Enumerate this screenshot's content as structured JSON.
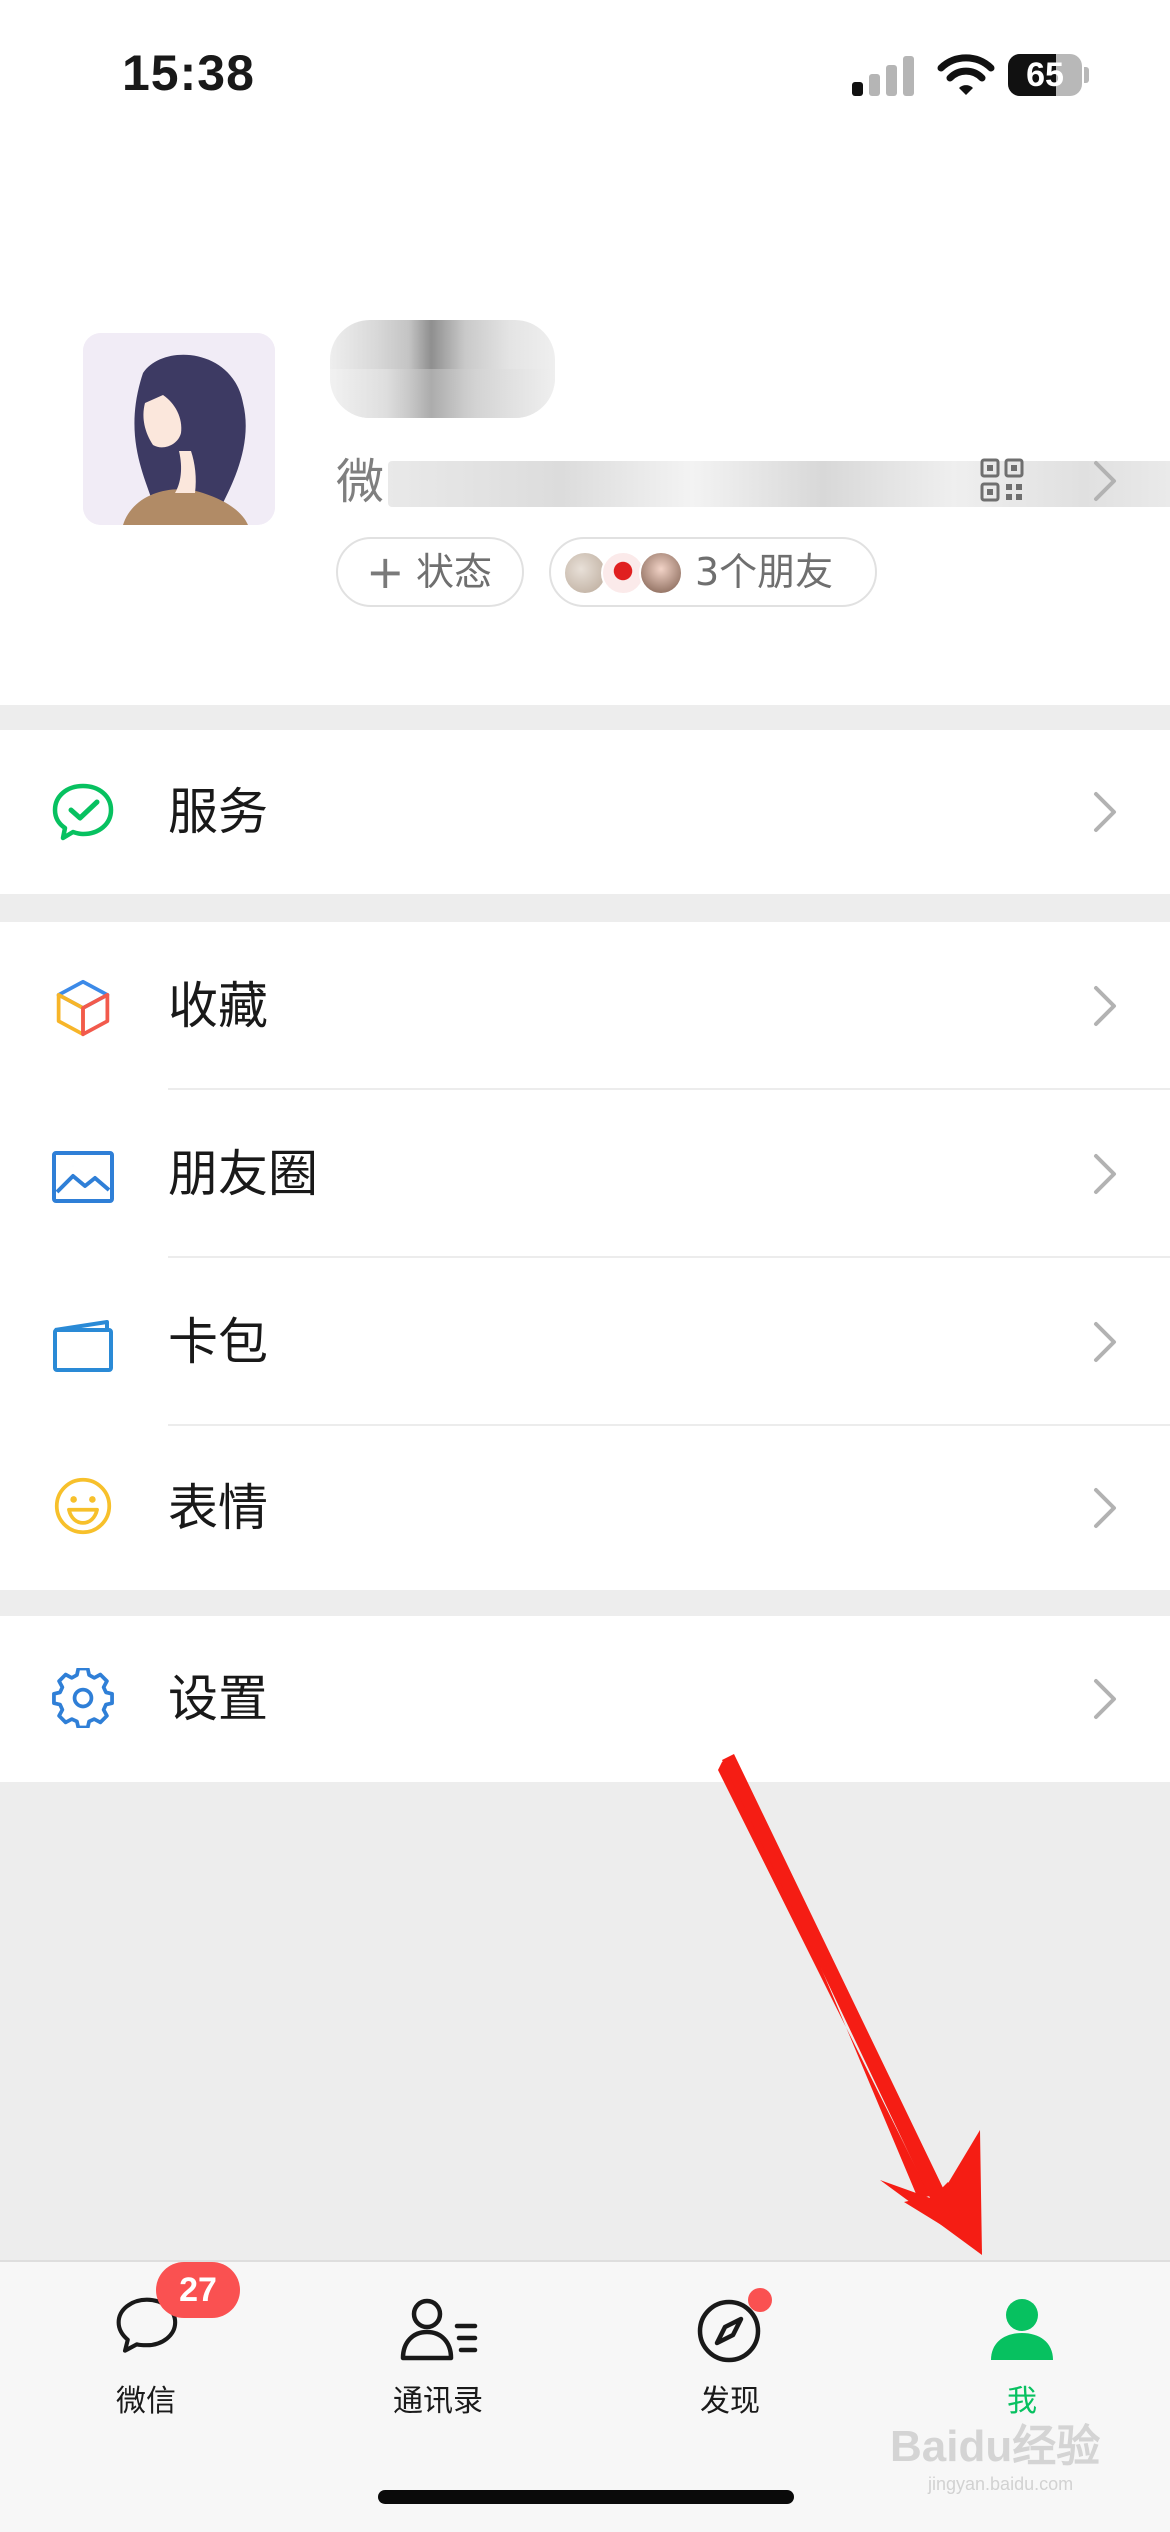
{
  "status_bar": {
    "time": "15:38",
    "battery_level": "65",
    "battery_fraction": 0.65
  },
  "profile": {
    "wechat_id_label": "微",
    "status_chip": {
      "plus": "+",
      "label": "状态"
    },
    "friends_chip": {
      "label": "3个朋友"
    }
  },
  "menu": {
    "services": {
      "label": "服务",
      "icon": "services-icon",
      "color": "#07c160"
    },
    "favorites": {
      "label": "收藏",
      "icon": "favorites-cube-icon"
    },
    "moments": {
      "label": "朋友圈",
      "icon": "moments-photo-icon",
      "color": "#2f7fd7"
    },
    "cards": {
      "label": "卡包",
      "icon": "card-wallet-icon",
      "color": "#2a8ad6"
    },
    "stickers": {
      "label": "表情",
      "icon": "smiley-icon",
      "color": "#f7c02b"
    },
    "settings": {
      "label": "设置",
      "icon": "gear-icon",
      "color": "#2f7fd7"
    }
  },
  "tabbar": {
    "chats": {
      "label": "微信",
      "badge": "27",
      "icon": "chat-bubble-icon"
    },
    "contacts": {
      "label": "通讯录",
      "icon": "contacts-icon"
    },
    "discover": {
      "label": "发现",
      "icon": "compass-icon"
    },
    "me": {
      "label": "我",
      "icon": "person-icon",
      "active": true,
      "active_color": "#07c160"
    }
  },
  "watermark": {
    "text": "Baidu经验",
    "subtext": "jingyan.baidu.com"
  }
}
